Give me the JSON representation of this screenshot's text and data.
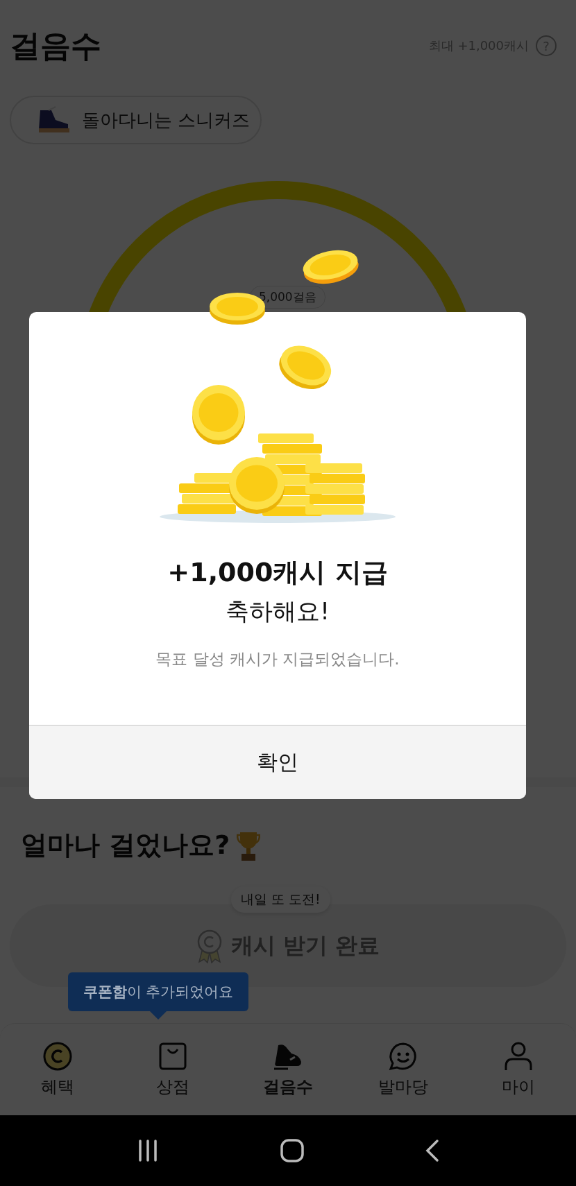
{
  "header": {
    "title": "걸음수",
    "reward": "최대 +1,000캐시",
    "help": "?"
  },
  "badge": {
    "label": "돌아다니는 스니커즈"
  },
  "ring": {
    "milestone": "5,000걸음"
  },
  "dialog": {
    "title": "+1,000캐시 지급",
    "heading": "축하해요!",
    "message": "목표 달성 캐시가 지급되었습니다.",
    "confirm": "확인"
  },
  "section": {
    "title": "얼마나 걸었나요?",
    "tooltip": "내일 또 도전!",
    "button": "캐시 받기 완료",
    "disabled": true
  },
  "toast": "**쿠폰함**이 추가되었어요",
  "nav": [
    {
      "label": "혜택",
      "kind": "coin",
      "selected": false
    },
    {
      "label": "상점",
      "kind": "bag",
      "selected": false
    },
    {
      "label": "걸음수",
      "kind": "sneaker",
      "selected": true
    },
    {
      "label": "발마당",
      "kind": "chat",
      "selected": false
    },
    {
      "label": "마이",
      "kind": "person",
      "selected": false
    }
  ]
}
